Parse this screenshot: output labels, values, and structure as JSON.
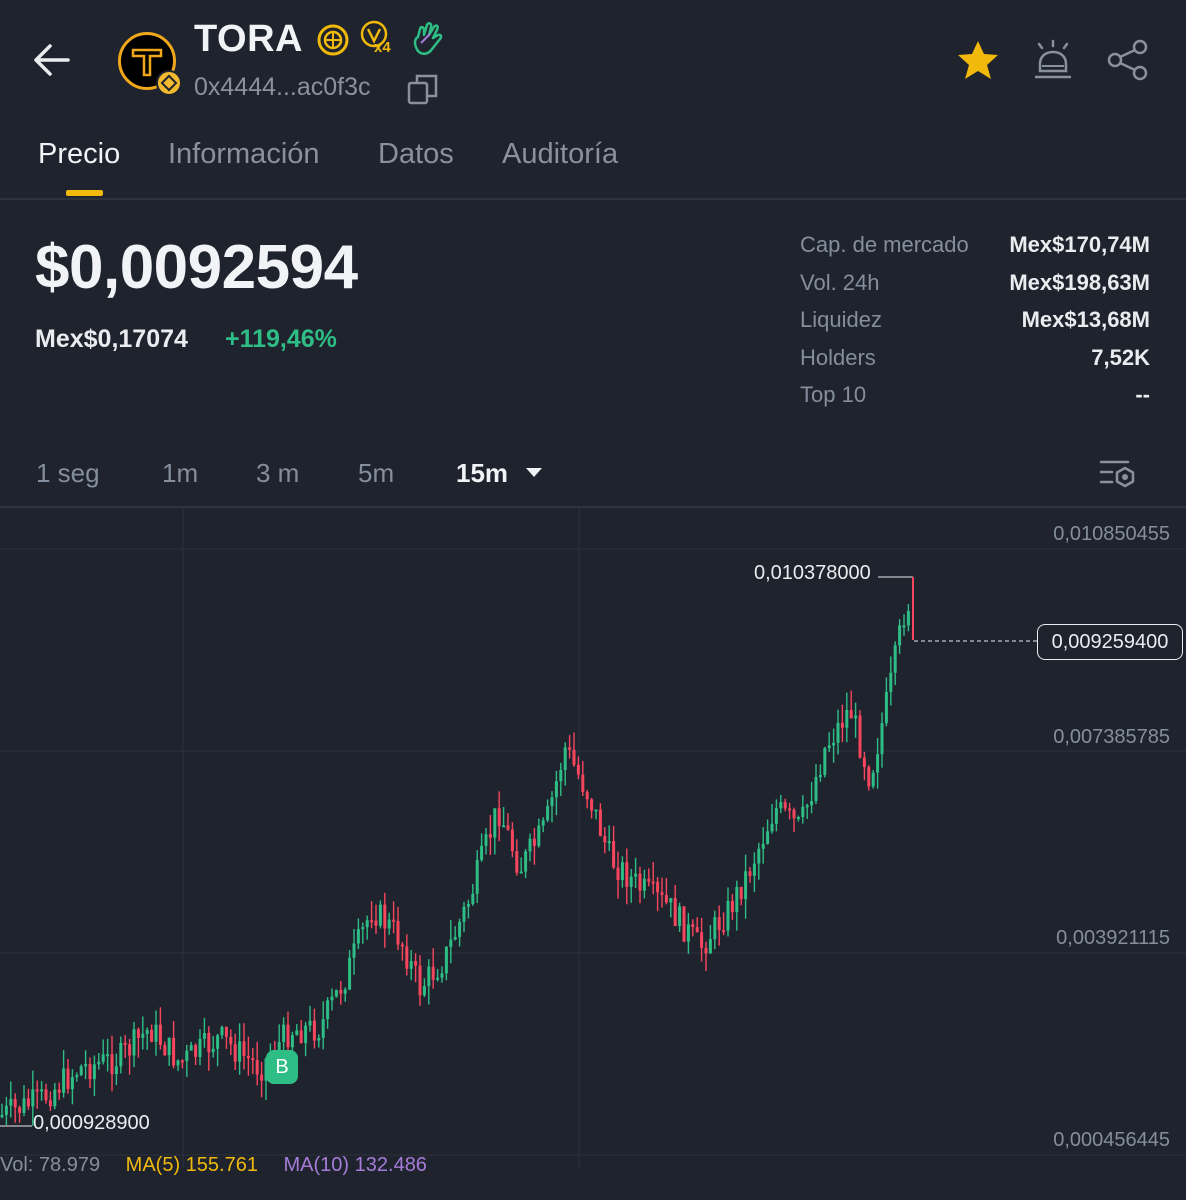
{
  "header": {
    "token_name": "TORA",
    "badge_multiplier": "x4",
    "address": "0x4444...ac0f3c",
    "logo_letter": "T"
  },
  "tabs": [
    {
      "label": "Precio",
      "active": true
    },
    {
      "label": "Información",
      "active": false
    },
    {
      "label": "Datos",
      "active": false
    },
    {
      "label": "Auditoría",
      "active": false
    }
  ],
  "price": {
    "usd": "$0,0092594",
    "fiat": "Mex$0,17074",
    "change": "+119,46%"
  },
  "stats": [
    {
      "label": "Cap. de mercado",
      "value": "Mex$170,74M"
    },
    {
      "label": "Vol. 24h",
      "value": "Mex$198,63M"
    },
    {
      "label": "Liquidez",
      "value": "Mex$13,68M"
    },
    {
      "label": "Holders",
      "value": "7,52K"
    },
    {
      "label": "Top 10",
      "value": "--"
    }
  ],
  "intervals": [
    {
      "label": "1 seg",
      "active": false
    },
    {
      "label": "1m",
      "active": false
    },
    {
      "label": "3 m",
      "active": false
    },
    {
      "label": "5m",
      "active": false
    },
    {
      "label": "15m",
      "active": true
    }
  ],
  "chart": {
    "axis_labels": [
      "0,010850455",
      "0,007385785",
      "0,003921115",
      "0,000456445"
    ],
    "high_label": "0,010378000",
    "low_label": "0,000928900",
    "current_price": "0,009259400",
    "buy_marker": "B",
    "volume": "Vol: 78.979",
    "ma5": "MA(5) 155.761",
    "ma10": "MA(10) 132.486"
  },
  "colors": {
    "background": "#1f232d",
    "up": "#2ebd85",
    "down": "#f6465d",
    "accent": "#f0b90b",
    "ma5": "#f0b90b",
    "ma10": "#a57cd9"
  },
  "icons": [
    "back-arrow-icon",
    "copy-icon",
    "star-icon",
    "price-alert-icon",
    "share-icon",
    "chart-settings-icon"
  ]
}
